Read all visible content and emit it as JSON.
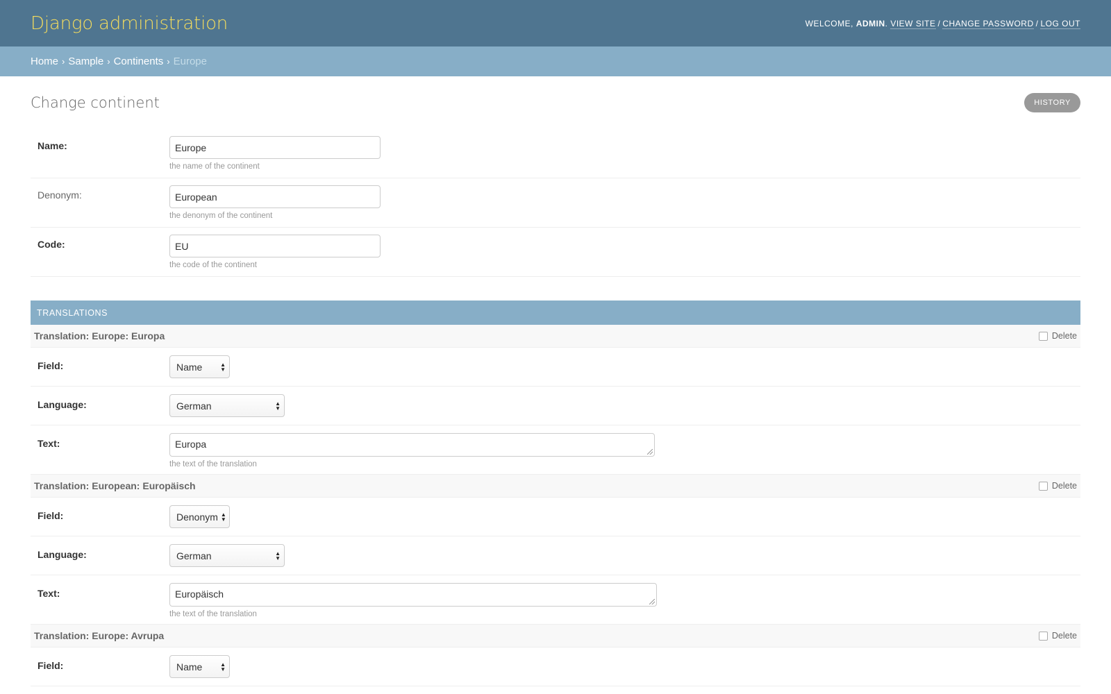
{
  "header": {
    "branding": "Django administration",
    "welcome": "Welcome,",
    "user": "admin",
    "view_site": "View site",
    "change_password": "Change password",
    "log_out": "Log out"
  },
  "breadcrumbs": {
    "home": "Home",
    "app": "Sample",
    "model": "Continents",
    "current": "Europe",
    "separator": "›"
  },
  "page": {
    "title": "Change continent",
    "history": "History"
  },
  "fields": {
    "name": {
      "label": "Name:",
      "value": "Europe",
      "help": "the name of the continent"
    },
    "denonym": {
      "label": "Denonym:",
      "value": "European",
      "help": "the denonym of the continent"
    },
    "code": {
      "label": "Code:",
      "value": "EU",
      "help": "the code of the continent"
    }
  },
  "translations": {
    "caption": "Translations",
    "delete_label": "Delete",
    "field_label": "Field:",
    "language_label": "Language:",
    "text_label": "Text:",
    "text_help": "the text of the translation",
    "items": [
      {
        "title": "Translation: Europe: Europa",
        "field": "Name",
        "language": "German",
        "text": "Europa"
      },
      {
        "title": "Translation: European: Europäisch",
        "field": "Denonym",
        "language": "German",
        "text": "Europäisch"
      },
      {
        "title": "Translation: Europe: Avrupa",
        "field": "Name"
      }
    ]
  },
  "colors": {
    "header_bg": "#4f7590",
    "branding": "#f5dd5d",
    "breadcrumbs_bg": "#87aec7",
    "caption_bg": "#87aec7"
  }
}
